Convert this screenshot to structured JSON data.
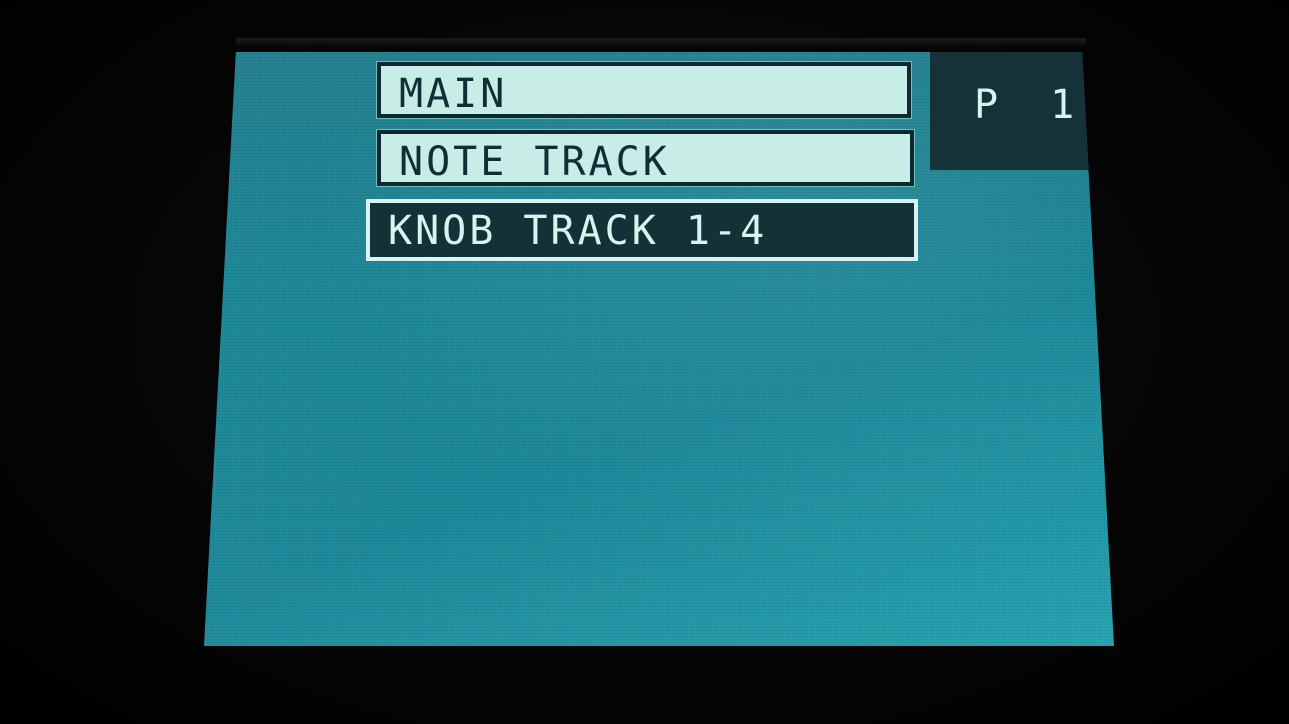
{
  "menu": {
    "items": [
      {
        "label": "MAIN",
        "selected": false
      },
      {
        "label": "NOTE TRACK",
        "selected": false
      },
      {
        "label": "KNOB TRACK 1-4",
        "selected": true
      }
    ]
  },
  "page_indicator": {
    "label": "P 1"
  },
  "colors": {
    "screen_background": "#1d8a9a",
    "item_background": "#c8ede6",
    "item_text": "#0e2f35",
    "selected_background": "#133238",
    "selected_text": "#d9f3ee"
  }
}
